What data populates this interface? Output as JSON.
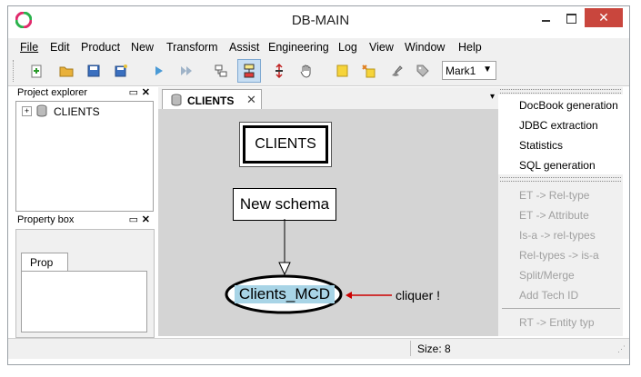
{
  "window": {
    "title": "DB-MAIN"
  },
  "menubar": {
    "items": [
      "File",
      "Edit",
      "Product",
      "New",
      "Transform",
      "Assist",
      "Engineering",
      "Log",
      "View",
      "Window",
      "Help"
    ]
  },
  "toolbar": {
    "mark_select": "Mark1"
  },
  "project_explorer": {
    "title": "Project explorer",
    "tree": [
      "CLIENTS"
    ]
  },
  "property_box": {
    "title": "Property box",
    "tab": "Prop"
  },
  "tab": {
    "label": "CLIENTS"
  },
  "diagram": {
    "node1": "CLIENTS",
    "node2": "New schema",
    "node3": "Clients_MCD",
    "annotation": "cliquer !"
  },
  "right_menu": {
    "enabled": [
      "DocBook generation",
      "JDBC extraction",
      "Statistics",
      "SQL generation"
    ],
    "disabled": [
      "ET -> Rel-type",
      "ET -> Attribute",
      "Is-a -> rel-types",
      "Rel-types -> is-a",
      "Split/Merge",
      "Add Tech ID"
    ],
    "last": "RT -> Entity typ"
  },
  "status": {
    "size": "Size: 8"
  },
  "colors": {
    "accent": "#2f6fb3",
    "highlight": "#a8d4e6",
    "arrow": "#cc0000"
  }
}
